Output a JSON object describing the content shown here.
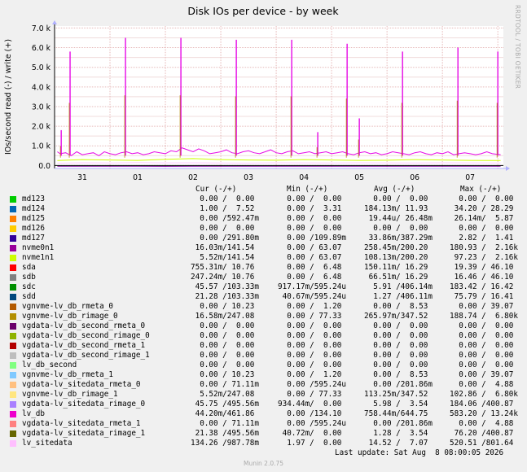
{
  "chart_data": {
    "type": "line",
    "title": "Disk IOs per device - by week",
    "ylabel": "IOs/second read (-) / write (+)",
    "xlabel": "",
    "y_ticks": [
      "0.0",
      "1.0 k",
      "2.0 k",
      "3.0 k",
      "4.0 k",
      "5.0 k",
      "6.0 k",
      "7.0 k"
    ],
    "y_tick_values": [
      0,
      1000,
      2000,
      3000,
      4000,
      5000,
      6000,
      7000
    ],
    "ylim": [
      -150,
      7100
    ],
    "x_ticks": [
      "31",
      "01",
      "02",
      "03",
      "04",
      "05",
      "06",
      "07"
    ],
    "x_tick_values": [
      0.5,
      1.5,
      2.5,
      3.5,
      4.5,
      5.5,
      6.5,
      7.5
    ],
    "xlim": [
      0,
      8.1
    ],
    "grid": true,
    "series": [
      {
        "name": "lv_db",
        "color": "#e60ae6",
        "x": [
          0.05,
          0.1,
          0.2,
          0.3,
          0.4,
          0.5,
          0.6,
          0.7,
          0.8,
          0.9,
          1.0,
          1.1,
          1.2,
          1.3,
          1.4,
          1.5,
          1.6,
          1.7,
          1.8,
          1.9,
          2.0,
          2.1,
          2.2,
          2.3,
          2.4,
          2.5,
          2.6,
          2.7,
          2.8,
          2.9,
          3.0,
          3.1,
          3.2,
          3.3,
          3.4,
          3.5,
          3.6,
          3.7,
          3.8,
          3.9,
          4.0,
          4.1,
          4.2,
          4.3,
          4.4,
          4.5,
          4.6,
          4.7,
          4.8,
          4.9,
          5.0,
          5.1,
          5.2,
          5.3,
          5.4,
          5.5,
          5.6,
          5.7,
          5.8,
          5.9,
          6.0,
          6.1,
          6.2,
          6.3,
          6.4,
          6.5,
          6.6,
          6.7,
          6.8,
          6.9,
          7.0,
          7.1,
          7.2,
          7.3,
          7.4,
          7.5,
          7.6,
          7.7,
          7.8,
          7.9,
          8.05
        ],
        "y": [
          700,
          600,
          650,
          500,
          700,
          550,
          600,
          650,
          500,
          700,
          600,
          550,
          650,
          700,
          600,
          650,
          550,
          600,
          700,
          650,
          600,
          750,
          700,
          900,
          800,
          700,
          850,
          750,
          600,
          650,
          700,
          800,
          650,
          600,
          700,
          750,
          650,
          600,
          700,
          800,
          650,
          600,
          700,
          750,
          600,
          650,
          700,
          600,
          650,
          700,
          600,
          650,
          700,
          600,
          550,
          650,
          700,
          600,
          650,
          550,
          600,
          700,
          650,
          600,
          550,
          650,
          700,
          600,
          550,
          650,
          600,
          700,
          550,
          600,
          650,
          600,
          550,
          600,
          700,
          600,
          550
        ]
      },
      {
        "name": "lv_sitedata",
        "color": "#ffccff",
        "x": [
          0.05,
          0.5,
          1.0,
          1.5,
          2.0,
          2.5,
          3.0,
          3.5,
          4.0,
          4.5,
          5.0,
          5.5,
          6.0,
          6.5,
          7.0,
          7.5,
          8.05
        ],
        "y": [
          120,
          140,
          130,
          150,
          135,
          140,
          130,
          125,
          140,
          135,
          130,
          140,
          135,
          130,
          140,
          135,
          130
        ]
      },
      {
        "name": "nvme1n1",
        "color": "#ccff00",
        "x": [
          0.05,
          0.5,
          1.0,
          1.5,
          2.0,
          2.5,
          3.0,
          3.5,
          4.0,
          4.5,
          5.0,
          5.5,
          6.0,
          6.5,
          7.0,
          7.5,
          8.05
        ],
        "y": [
          250,
          300,
          280,
          260,
          320,
          350,
          300,
          280,
          270,
          300,
          280,
          260,
          270,
          300,
          280,
          260,
          250
        ]
      },
      {
        "name": "nvme0n1",
        "color": "#7b0099",
        "x": [
          0.05,
          0.5,
          1.0,
          1.5,
          2.0,
          2.5,
          3.0,
          3.5,
          4.0,
          4.5,
          5.0,
          5.5,
          6.0,
          6.5,
          7.0,
          7.5,
          8.05
        ],
        "y": [
          -40,
          -35,
          -40,
          -38,
          -42,
          -40,
          -36,
          -40,
          -38,
          -40,
          -39,
          -37,
          -40,
          -38,
          -40,
          -39,
          -40
        ]
      }
    ],
    "spikes": [
      {
        "x": 0.28,
        "y": 5800
      },
      {
        "x": 1.28,
        "y": 6500
      },
      {
        "x": 2.28,
        "y": 6500
      },
      {
        "x": 3.28,
        "y": 6400
      },
      {
        "x": 4.28,
        "y": 6400
      },
      {
        "x": 5.28,
        "y": 6200
      },
      {
        "x": 6.28,
        "y": 5800
      },
      {
        "x": 7.28,
        "y": 6000
      },
      {
        "x": 8.0,
        "y": 5800
      },
      {
        "x": 0.12,
        "y": 1800
      },
      {
        "x": 5.5,
        "y": 2400
      },
      {
        "x": 4.75,
        "y": 1700
      }
    ],
    "spike_color": "#e60ae6"
  },
  "legend": {
    "headers": {
      "cur": "Cur (-/+)",
      "min": "Min (-/+)",
      "avg": "Avg (-/+)",
      "max": "Max (-/+)"
    },
    "rows": [
      {
        "name": "md123",
        "color": "#00cc00",
        "cur": "  0.00 /  0.00",
        "min": "  0.00 /  0.00",
        "avg": "  0.00 /  0.00",
        "max": "  0.00 /  0.00"
      },
      {
        "name": "md124",
        "color": "#0066b3",
        "cur": "  1.00 /  7.52",
        "min": "  0.00 /  3.31",
        "avg": "184.13m/ 11.93",
        "max": " 34.20 / 28.29"
      },
      {
        "name": "md125",
        "color": "#ff8000",
        "cur": "  0.00 /592.47m",
        "min": "  0.00 /  0.00",
        "avg": " 19.44u/ 26.48m",
        "max": " 26.14m/  5.87"
      },
      {
        "name": "md126",
        "color": "#ffcc00",
        "cur": "  0.00 /  0.00",
        "min": "  0.00 /  0.00",
        "avg": "  0.00 /  0.00",
        "max": "  0.00 /  0.00"
      },
      {
        "name": "md127",
        "color": "#330099",
        "cur": "  0.00 /291.80m",
        "min": "  0.00 /109.89m",
        "avg": " 33.86m/387.29m",
        "max": "  2.82 /  1.41"
      },
      {
        "name": "nvme0n1",
        "color": "#990099",
        "cur": " 16.03m/141.54",
        "min": "  0.00 / 63.07",
        "avg": "258.45m/200.20",
        "max": "180.93 /  2.16k"
      },
      {
        "name": "nvme1n1",
        "color": "#ccff00",
        "cur": "  5.52m/141.54",
        "min": "  0.00 / 63.07",
        "avg": "108.13m/200.20",
        "max": " 97.23 /  2.16k"
      },
      {
        "name": "sda",
        "color": "#ff0000",
        "cur": "755.31m/ 10.76",
        "min": "  0.00 /  6.48",
        "avg": "150.11m/ 16.29",
        "max": " 19.39 / 46.10"
      },
      {
        "name": "sdb",
        "color": "#808080",
        "cur": "247.24m/ 10.76",
        "min": "  0.00 /  6.48",
        "avg": " 66.51m/ 16.29",
        "max": " 16.46 / 46.10"
      },
      {
        "name": "sdc",
        "color": "#008f00",
        "cur": " 45.57 /103.33m",
        "min": "917.17m/595.24u",
        "avg": "  5.91 /406.14m",
        "max": "183.42 / 16.42"
      },
      {
        "name": "sdd",
        "color": "#00487d",
        "cur": " 21.28 /103.33m",
        "min": " 40.67m/595.24u",
        "avg": "  1.27 /406.11m",
        "max": " 75.79 / 16.41"
      },
      {
        "name": "vgnvme-lv_db_rmeta_0",
        "color": "#b35a00",
        "cur": "  0.00 / 10.23",
        "min": "  0.00 /  1.20",
        "avg": "  0.00 /  8.53",
        "max": "  0.00 / 39.07"
      },
      {
        "name": "vgnvme-lv_db_rimage_0",
        "color": "#b38f00",
        "cur": " 16.58m/247.08",
        "min": "  0.00 / 77.33",
        "avg": "265.97m/347.52",
        "max": "188.74 /  6.80k"
      },
      {
        "name": "vgdata-lv_db_second_rmeta_0",
        "color": "#6b006b",
        "cur": "  0.00 /  0.00",
        "min": "  0.00 /  0.00",
        "avg": "  0.00 /  0.00",
        "max": "  0.00 /  0.00"
      },
      {
        "name": "vgdata-lv_db_second_rimage_0",
        "color": "#8fb300",
        "cur": "  0.00 /  0.00",
        "min": "  0.00 /  0.00",
        "avg": "  0.00 /  0.00",
        "max": "  0.00 /  0.00"
      },
      {
        "name": "vgdata-lv_db_second_rmeta_1",
        "color": "#b30000",
        "cur": "  0.00 /  0.00",
        "min": "  0.00 /  0.00",
        "avg": "  0.00 /  0.00",
        "max": "  0.00 /  0.00"
      },
      {
        "name": "vgdata-lv_db_second_rimage_1",
        "color": "#bebebe",
        "cur": "  0.00 /  0.00",
        "min": "  0.00 /  0.00",
        "avg": "  0.00 /  0.00",
        "max": "  0.00 /  0.00"
      },
      {
        "name": "lv_db_second",
        "color": "#80ff80",
        "cur": "  0.00 /  0.00",
        "min": "  0.00 /  0.00",
        "avg": "  0.00 /  0.00",
        "max": "  0.00 /  0.00"
      },
      {
        "name": "vgnvme-lv_db_rmeta_1",
        "color": "#80c9ff",
        "cur": "  0.00 / 10.23",
        "min": "  0.00 /  1.20",
        "avg": "  0.00 /  8.53",
        "max": "  0.00 / 39.07"
      },
      {
        "name": "vgdata-lv_sitedata_rmeta_0",
        "color": "#ffc080",
        "cur": "  0.00 / 71.11m",
        "min": "  0.00 /595.24u",
        "avg": "  0.00 /201.86m",
        "max": "  0.00 /  4.88"
      },
      {
        "name": "vgnvme-lv_db_rimage_1",
        "color": "#ffe680",
        "cur": "  5.52m/247.08",
        "min": "  0.00 / 77.33",
        "avg": "113.25m/347.52",
        "max": "102.86 /  6.80k"
      },
      {
        "name": "vgdata-lv_sitedata_rimage_0",
        "color": "#aa80ff",
        "cur": " 45.75 /495.56m",
        "min": "934.44m/  0.00",
        "avg": "  5.98 /  3.54",
        "max": "184.06 /400.87"
      },
      {
        "name": "lv_db",
        "color": "#ee00cc",
        "cur": " 44.20m/461.86",
        "min": "  0.00 /134.10",
        "avg": "758.44m/644.75",
        "max": "583.20 / 13.24k"
      },
      {
        "name": "vgdata-lv_sitedata_rmeta_1",
        "color": "#ff8080",
        "cur": "  0.00 / 71.11m",
        "min": "  0.00 /595.24u",
        "avg": "  0.00 /201.86m",
        "max": "  0.00 /  4.88"
      },
      {
        "name": "vgdata-lv_sitedata_rimage_1",
        "color": "#666600",
        "cur": " 21.38 /495.56m",
        "min": " 40.72m/  0.00",
        "avg": "  1.28 /  3.54",
        "max": " 76.20 /400.87"
      },
      {
        "name": "lv_sitedata",
        "color": "#ffbfff",
        "cur": "134.26 /987.78m",
        "min": "  1.97 /  0.00",
        "avg": " 14.52 /  7.07",
        "max": "520.51 /801.64"
      }
    ]
  },
  "last_update": "Last update: Sat Aug  8 08:00:05 2026",
  "footer": "Munin 2.0.75",
  "side_label": "RRDTOOL / TOBI OETIKER"
}
